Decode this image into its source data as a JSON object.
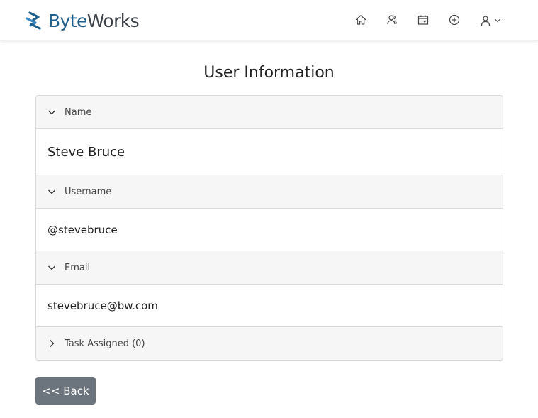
{
  "brand": {
    "part1": "Byte",
    "part2": "Works",
    "icon": "byteworks-logo-icon"
  },
  "nav": {
    "icons": [
      "home-icon",
      "users-icon",
      "calendar-icon",
      "add-circle-icon"
    ],
    "user_icon": "user-icon",
    "dropdown_icon": "chevron-down-icon"
  },
  "page": {
    "title": "User Information"
  },
  "sections": {
    "name": {
      "label": "Name",
      "value": "Steve Bruce",
      "expanded": true
    },
    "username": {
      "label": "Username",
      "value": "@stevebruce",
      "expanded": true
    },
    "email": {
      "label": "Email",
      "value": "stevebruce@bw.com",
      "expanded": true
    },
    "tasks": {
      "label": "Task Assigned (0)",
      "expanded": false
    }
  },
  "actions": {
    "back_label": "<< Back"
  },
  "colors": {
    "brand_primary": "#1e5f8c",
    "brand_secondary": "#3d4248",
    "button_bg": "#6c757d",
    "header_bg": "#f6f6f7",
    "border": "#d7d9db"
  }
}
